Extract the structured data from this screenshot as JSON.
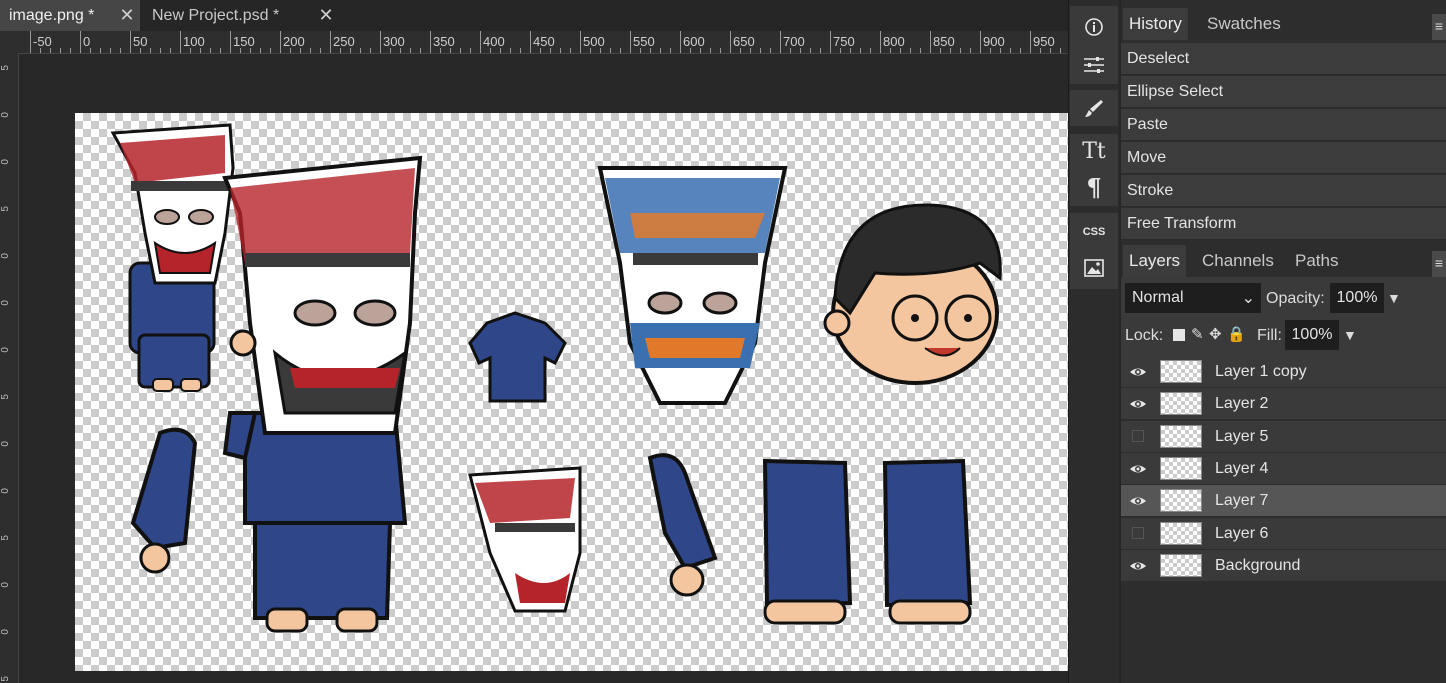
{
  "tabs": [
    {
      "label": "image.png *",
      "close": "✕"
    },
    {
      "label": "New Project.psd *",
      "close": "✕"
    }
  ],
  "ruler": {
    "labels": [
      "-50",
      "0",
      "50",
      "100",
      "150",
      "200",
      "250",
      "300",
      "350",
      "400",
      "450",
      "500",
      "550",
      "600",
      "650",
      "700",
      "750",
      "800",
      "850",
      "900",
      "950"
    ],
    "vertical_labels": [
      "5",
      "0",
      "0",
      "5",
      "0",
      "0",
      "0",
      "5",
      "0",
      "0",
      "5",
      "0",
      "0",
      "5"
    ]
  },
  "tools": [
    {
      "name": "info-icon",
      "glyph": "ⓘ"
    },
    {
      "name": "adjust-icon",
      "glyph": "☰"
    },
    {
      "name": "brush-icon",
      "glyph": "🖌"
    },
    {
      "name": "text-icon",
      "glyph": "Tt"
    },
    {
      "name": "paragraph-icon",
      "glyph": "¶"
    },
    {
      "name": "css-icon",
      "glyph": "CSS"
    },
    {
      "name": "image-icon",
      "glyph": "▣"
    }
  ],
  "history_panel": {
    "tabs": [
      "History",
      "Swatches"
    ],
    "menu": "≡",
    "items": [
      "Deselect",
      "Ellipse Select",
      "Paste",
      "Move",
      "Stroke",
      "Free Transform"
    ]
  },
  "layers_panel": {
    "tabs": [
      "Layers",
      "Channels",
      "Paths"
    ],
    "menu": "≡",
    "blend_mode": "Normal",
    "opacity_label": "Opacity:",
    "opacity_value": "100%",
    "lock_label": "Lock:",
    "fill_label": "Fill:",
    "fill_value": "100%",
    "layers": [
      {
        "name": "Layer 1 copy",
        "visible": true,
        "selected": false
      },
      {
        "name": "Layer 2",
        "visible": true,
        "selected": false
      },
      {
        "name": "Layer 5",
        "visible": false,
        "selected": false
      },
      {
        "name": "Layer 4",
        "visible": true,
        "selected": false
      },
      {
        "name": "Layer 7",
        "visible": true,
        "selected": true
      },
      {
        "name": "Layer 6",
        "visible": false,
        "selected": false
      },
      {
        "name": "Background",
        "visible": true,
        "selected": false
      }
    ]
  },
  "colors": {
    "shirt": "#2f4688",
    "mask_red": "#b5242b",
    "mask_dark": "#3a3a3a",
    "skin": "#f4c6a0",
    "mask_blue": "#3a6fb0",
    "mask_orange": "#e07a2a"
  }
}
